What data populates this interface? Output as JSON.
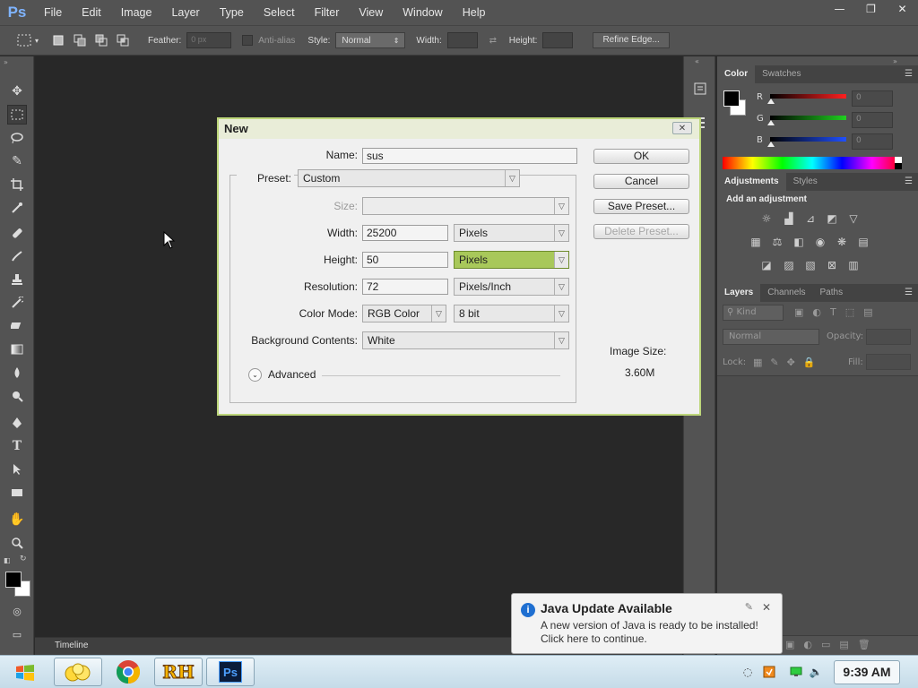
{
  "app": {
    "logo": "Ps"
  },
  "menu": [
    "File",
    "Edit",
    "Image",
    "Layer",
    "Type",
    "Select",
    "Filter",
    "View",
    "Window",
    "Help"
  ],
  "window_controls": {
    "minimize": "—",
    "restore": "❐",
    "close": "✕"
  },
  "options": {
    "feather_label": "Feather:",
    "feather_value": "0 px",
    "antialias_label": "Anti-alias",
    "style_label": "Style:",
    "style_value": "Normal",
    "width_label": "Width:",
    "height_label": "Height:",
    "refine_edge": "Refine Edge..."
  },
  "color_panel": {
    "tabs": [
      "Color",
      "Swatches"
    ],
    "channels": [
      {
        "name": "R",
        "value": "0",
        "color": "#ff2020"
      },
      {
        "name": "G",
        "value": "0",
        "color": "#20d020"
      },
      {
        "name": "B",
        "value": "0",
        "color": "#2050ff"
      }
    ]
  },
  "adjustments_panel": {
    "tabs": [
      "Adjustments",
      "Styles"
    ],
    "heading": "Add an adjustment"
  },
  "layers_panel": {
    "tabs": [
      "Layers",
      "Channels",
      "Paths"
    ],
    "kind_label": "Kind",
    "blend_mode": "Normal",
    "opacity_label": "Opacity:",
    "lock_label": "Lock:",
    "fill_label": "Fill:"
  },
  "timeline": {
    "label": "Timeline"
  },
  "dialog": {
    "title": "New",
    "name_label": "Name:",
    "name_value": "sus",
    "preset_label": "Preset:",
    "preset_value": "Custom",
    "size_label": "Size:",
    "width_label": "Width:",
    "width_value": "25200",
    "width_unit": "Pixels",
    "height_label": "Height:",
    "height_value": "50",
    "height_unit": "Pixels",
    "resolution_label": "Resolution:",
    "resolution_value": "72",
    "resolution_unit": "Pixels/Inch",
    "color_mode_label": "Color Mode:",
    "color_mode_value": "RGB Color",
    "bit_depth": "8 bit",
    "bg_label": "Background Contents:",
    "bg_value": "White",
    "advanced_label": "Advanced",
    "buttons": {
      "ok": "OK",
      "cancel": "Cancel",
      "save_preset": "Save Preset...",
      "delete_preset": "Delete Preset..."
    },
    "image_size_label": "Image Size:",
    "image_size_value": "3.60M"
  },
  "notification": {
    "title": "Java Update Available",
    "line1": "A new version of Java is ready to be installed!",
    "line2": "Click here to continue."
  },
  "taskbar": {
    "clock": "9:39 AM",
    "pinned": [
      "folder-icon",
      "chrome-icon",
      "rh-icon",
      "photoshop-icon"
    ],
    "rh_label": "RH",
    "ps_label": "Ps"
  }
}
